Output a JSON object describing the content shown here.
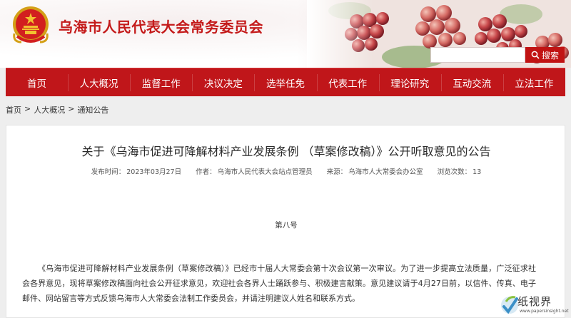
{
  "header": {
    "site_title": "乌海市人民代表大会常务委员会",
    "emblem": "national-emblem",
    "banner_image": "grapes"
  },
  "search": {
    "value": "",
    "placeholder": "",
    "button_label": "搜索",
    "icon": "search-icon"
  },
  "nav": {
    "items": [
      {
        "label": "首页"
      },
      {
        "label": "人大概况"
      },
      {
        "label": "监督工作"
      },
      {
        "label": "决议决定"
      },
      {
        "label": "选举任免"
      },
      {
        "label": "代表工作"
      },
      {
        "label": "理论研究"
      },
      {
        "label": "互动交流"
      },
      {
        "label": "立法工作"
      }
    ]
  },
  "breadcrumb": {
    "items": [
      "首页",
      "人大概况",
      "通知公告"
    ],
    "separator": ">"
  },
  "article": {
    "title": "关于《乌海市促进可降解材料产业发展条例 （草案修改稿）》公开听取意见的公告",
    "meta": {
      "date_label": "发布时间：",
      "date": "2023年03月27日",
      "author_label": "作者：",
      "author": "乌海市人民代表大会站点管理员",
      "source_label": "来源：",
      "source": "乌海市人大常委会办公室",
      "views_label": "浏览次数：",
      "views": "13"
    },
    "doc_number": "第八号",
    "body": "《乌海市促进可降解材料产业发展条例（草案修改稿）》已经市十届人大常委会第十次会议第一次审议。为了进一步提高立法质量，广泛征求社会各界意见，现将草案修改稿面向社会公开征求意见，欢迎社会各界人士踊跃参与、积极建言献策。意见建议请于4月27日前，以信件、传真、电子邮件、网站留言等方式反馈乌海市人大常委会法制工作委员会，并请注明建议人姓名和联系方式。"
  },
  "watermark": {
    "text": "纸视界",
    "url": "www.papersinsight.net"
  },
  "colors": {
    "brand_red": "#c0161a",
    "title_red": "#c41a1a",
    "page_bg": "#eeeeee"
  }
}
